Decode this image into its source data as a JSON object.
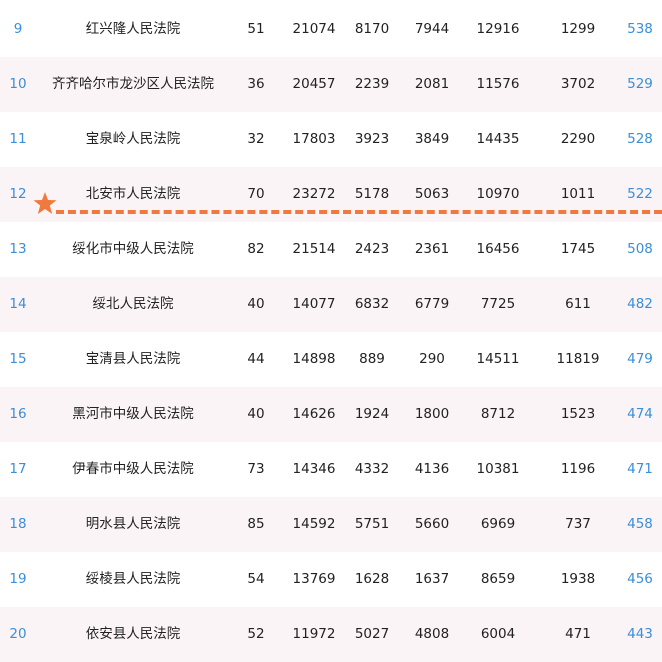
{
  "rows": [
    {
      "rank": "9",
      "name": "红兴隆人民法院",
      "c1": "51",
      "c2": "21074",
      "c3": "8170",
      "c4": "7944",
      "c5": "12916",
      "c6": "1299",
      "score": "538"
    },
    {
      "rank": "10",
      "name": "齐齐哈尔市龙沙区人民法院",
      "c1": "36",
      "c2": "20457",
      "c3": "2239",
      "c4": "2081",
      "c5": "11576",
      "c6": "3702",
      "score": "529"
    },
    {
      "rank": "11",
      "name": "宝泉岭人民法院",
      "c1": "32",
      "c2": "17803",
      "c3": "3923",
      "c4": "3849",
      "c5": "14435",
      "c6": "2290",
      "score": "528"
    },
    {
      "rank": "12",
      "name": "北安市人民法院",
      "c1": "70",
      "c2": "23272",
      "c3": "5178",
      "c4": "5063",
      "c5": "10970",
      "c6": "1011",
      "score": "522"
    },
    {
      "rank": "13",
      "name": "绥化市中级人民法院",
      "c1": "82",
      "c2": "21514",
      "c3": "2423",
      "c4": "2361",
      "c5": "16456",
      "c6": "1745",
      "score": "508"
    },
    {
      "rank": "14",
      "name": "绥北人民法院",
      "c1": "40",
      "c2": "14077",
      "c3": "6832",
      "c4": "6779",
      "c5": "7725",
      "c6": "611",
      "score": "482"
    },
    {
      "rank": "15",
      "name": "宝清县人民法院",
      "c1": "44",
      "c2": "14898",
      "c3": "889",
      "c4": "290",
      "c5": "14511",
      "c6": "11819",
      "score": "479"
    },
    {
      "rank": "16",
      "name": "黑河市中级人民法院",
      "c1": "40",
      "c2": "14626",
      "c3": "1924",
      "c4": "1800",
      "c5": "8712",
      "c6": "1523",
      "score": "474"
    },
    {
      "rank": "17",
      "name": "伊春市中级人民法院",
      "c1": "73",
      "c2": "14346",
      "c3": "4332",
      "c4": "4136",
      "c5": "10381",
      "c6": "1196",
      "score": "471"
    },
    {
      "rank": "18",
      "name": "明水县人民法院",
      "c1": "85",
      "c2": "14592",
      "c3": "5751",
      "c4": "5660",
      "c5": "6969",
      "c6": "737",
      "score": "458"
    },
    {
      "rank": "19",
      "name": "绥棱县人民法院",
      "c1": "54",
      "c2": "13769",
      "c3": "1628",
      "c4": "1637",
      "c5": "8659",
      "c6": "1938",
      "score": "456"
    },
    {
      "rank": "20",
      "name": "依安县人民法院",
      "c1": "52",
      "c2": "11972",
      "c3": "5027",
      "c4": "4808",
      "c5": "6004",
      "c6": "471",
      "score": "443"
    }
  ],
  "colors": {
    "accent_blue": "#3a8fd8",
    "cutoff_orange": "#f07a3e",
    "alt_row": "#fbf4f6"
  },
  "marker": {
    "icon": "star-icon"
  }
}
